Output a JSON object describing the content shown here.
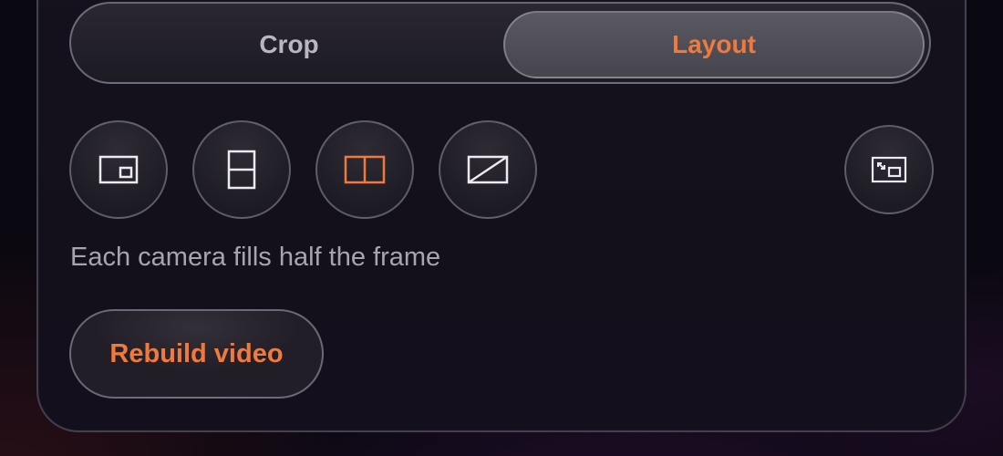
{
  "tabs": {
    "crop_label": "Crop",
    "layout_label": "Layout",
    "selected": "Layout"
  },
  "layouts": [
    {
      "name": "picture-in-picture",
      "icon": "picture-in-picture-icon",
      "selected": false
    },
    {
      "name": "stacked",
      "icon": "split-horizontal-icon",
      "selected": false
    },
    {
      "name": "side-by-side",
      "icon": "split-vertical-icon",
      "selected": true
    },
    {
      "name": "diagonal",
      "icon": "split-diagonal-icon",
      "selected": false
    }
  ],
  "swap_icon": "swap-positions-icon",
  "description": "Each camera fills half the frame",
  "rebuild_label": "Rebuild video",
  "colors": {
    "accent": "#f07a3e",
    "icon": "#ece9f0",
    "text_muted": "#a8a4ae"
  }
}
